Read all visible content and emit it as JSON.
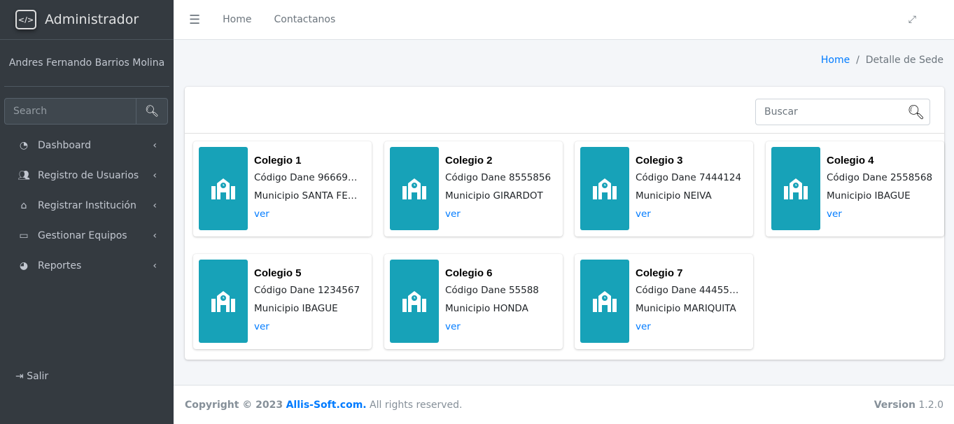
{
  "sidebar": {
    "brand": "Administrador",
    "user": "Andres Fernando Barrios Molina",
    "search_placeholder": "Search",
    "items": [
      {
        "label": "Dashboard",
        "icon": "tachometer-icon"
      },
      {
        "label": "Registro de Usuarios",
        "icon": "users-icon"
      },
      {
        "label": "Registrar Institución",
        "icon": "school-icon"
      },
      {
        "label": "Gestionar Equipos",
        "icon": "desktop-icon"
      },
      {
        "label": "Reportes",
        "icon": "pie-chart-icon"
      }
    ],
    "logout": "Salir"
  },
  "topbar": {
    "links": [
      "Home",
      "Contactanos"
    ]
  },
  "breadcrumb": {
    "home": "Home",
    "current": "Detalle de Sede"
  },
  "search": {
    "placeholder": "Buscar"
  },
  "colors": {
    "accent": "#17a2b8",
    "sidebar": "#343a40",
    "link": "#007bff"
  },
  "sedes": [
    {
      "title": "Colegio 1",
      "codigo": "Código Dane 96669…",
      "municipio": "Municipio SANTA FE…",
      "link": "ver"
    },
    {
      "title": "Colegio 2",
      "codigo": "Código Dane 8555856",
      "municipio": "Municipio GIRARDOT",
      "link": "ver"
    },
    {
      "title": "Colegio 3",
      "codigo": "Código Dane 7444124",
      "municipio": "Municipio NEIVA",
      "link": "ver"
    },
    {
      "title": "Colegio 4",
      "codigo": "Código Dane 2558568",
      "municipio": "Municipio IBAGUE",
      "link": "ver"
    },
    {
      "title": "Colegio 5",
      "codigo": "Código Dane 1234567",
      "municipio": "Municipio IBAGUE",
      "link": "ver"
    },
    {
      "title": "Colegio 6",
      "codigo": "Código Dane 55588",
      "municipio": "Municipio HONDA",
      "link": "ver"
    },
    {
      "title": "Colegio 7",
      "codigo": "Código Dane 44455…",
      "municipio": "Municipio MARIQUITA",
      "link": "ver"
    }
  ],
  "footer": {
    "copyright": "Copyright © 2023",
    "brand": "Allis-Soft.com.",
    "rights": " All rights reserved.",
    "version_label": "Version",
    "version": "1.2.0"
  }
}
